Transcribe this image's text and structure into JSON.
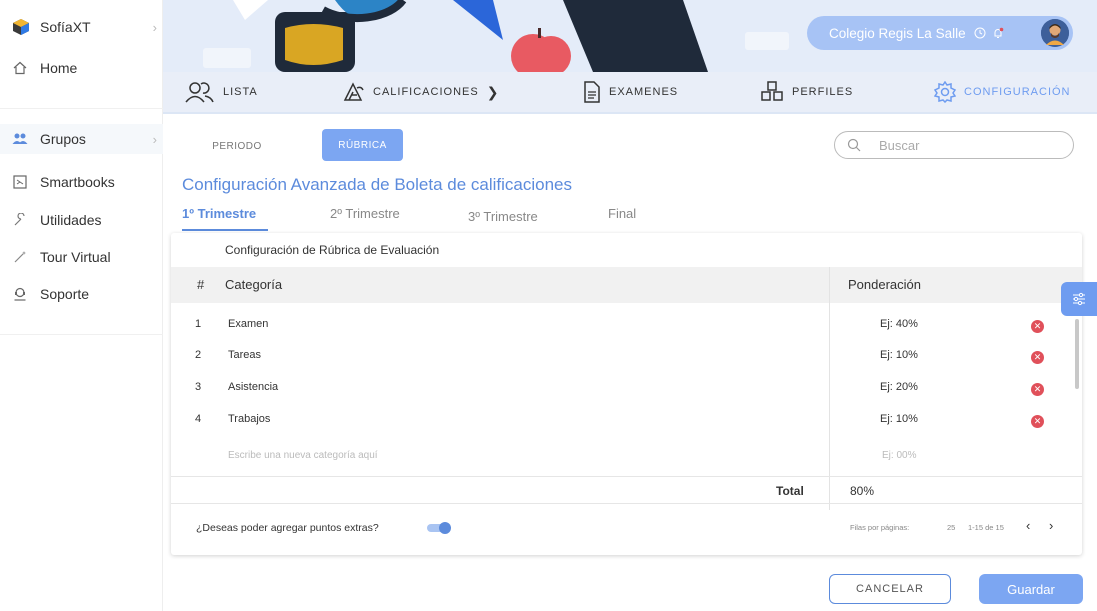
{
  "sidebar": {
    "brand": "SofíaXT",
    "items": [
      {
        "label": "Home",
        "icon": "home-icon"
      },
      {
        "label": "Grupos",
        "icon": "users-icon"
      },
      {
        "label": "Smartbooks",
        "icon": "book-icon"
      },
      {
        "label": "Utilidades",
        "icon": "wrench-icon"
      },
      {
        "label": "Tour Virtual",
        "icon": "magic-wand-icon"
      },
      {
        "label": "Soporte",
        "icon": "support-icon"
      }
    ]
  },
  "header": {
    "school": "Colegio Regis La Salle"
  },
  "tabs": [
    {
      "label": "LISTA",
      "icon": "people-icon"
    },
    {
      "label": "CALIFICACIONES",
      "icon": "grade-icon"
    },
    {
      "label": "EXAMENES",
      "icon": "document-icon"
    },
    {
      "label": "PERFILES",
      "icon": "cubes-icon"
    },
    {
      "label": "CONFIGURACIÓN",
      "icon": "gear-icon"
    }
  ],
  "segment": {
    "periodo": "PERIODO",
    "rubrica": "RÚBRICA"
  },
  "search": {
    "placeholder": "Buscar"
  },
  "page_title": "Configuración Avanzada de Boleta de calificaciones",
  "trimesters": [
    "1º Trimestre",
    "2º Trimestre",
    "3º Trimestre",
    "Final"
  ],
  "card": {
    "title": "Configuración de Rúbrica de Evaluación",
    "columns": {
      "num": "#",
      "category": "Categoría",
      "weight": "Ponderación"
    },
    "rows": [
      {
        "num": "1",
        "category": "Examen",
        "weight": "Ej: 40%"
      },
      {
        "num": "2",
        "category": "Tareas",
        "weight": "Ej: 10%"
      },
      {
        "num": "3",
        "category": "Asistencia",
        "weight": "Ej: 20%"
      },
      {
        "num": "4",
        "category": "Trabajos",
        "weight": "Ej: 10%"
      }
    ],
    "new_row": {
      "placeholder": "Escribe una nueva categoría aquí",
      "weight_placeholder": "Ej: 00%"
    },
    "total_label": "Total",
    "total_value": "80%",
    "extras_question": "¿Deseas poder agregar puntos extras?",
    "extras_enabled": true,
    "pager": {
      "rows_label": "Filas por páginas:",
      "rows_value": "25",
      "range": "1-15 de 15"
    }
  },
  "buttons": {
    "cancel": "CANCELAR",
    "save": "Guardar"
  },
  "colors": {
    "accent": "#5c8bdc",
    "primary_button": "#7ca6f2",
    "delete": "#e0505a"
  }
}
